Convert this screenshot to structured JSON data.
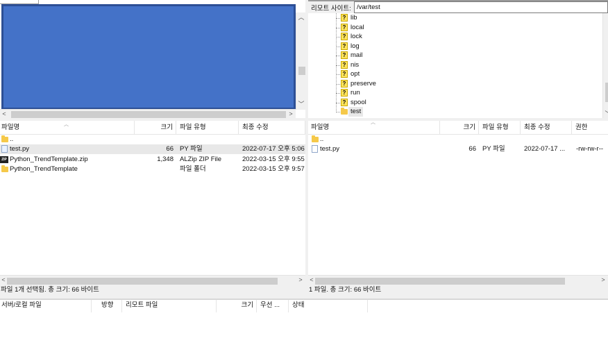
{
  "remote_site": {
    "label": "리모트 사이트:",
    "path": "/var/test"
  },
  "remote_tree": {
    "items": [
      {
        "label": "lib",
        "icon": "question-folder-icon"
      },
      {
        "label": "local",
        "icon": "question-folder-icon"
      },
      {
        "label": "lock",
        "icon": "question-folder-icon"
      },
      {
        "label": "log",
        "icon": "question-folder-icon"
      },
      {
        "label": "mail",
        "icon": "question-folder-icon"
      },
      {
        "label": "nis",
        "icon": "question-folder-icon"
      },
      {
        "label": "opt",
        "icon": "question-folder-icon"
      },
      {
        "label": "preserve",
        "icon": "question-folder-icon"
      },
      {
        "label": "run",
        "icon": "question-folder-icon"
      },
      {
        "label": "spool",
        "icon": "question-folder-icon"
      },
      {
        "label": "test",
        "icon": "folder-icon"
      }
    ]
  },
  "local_list": {
    "columns": {
      "name": "파일명",
      "size": "크기",
      "type": "파일 유형",
      "modified": "최종 수정"
    },
    "parent": "..",
    "rows": [
      {
        "name": "test.py",
        "size": "66",
        "type": "PY 파일",
        "modified": "2022-07-17 오후 5:06",
        "icon": "python-file-icon"
      },
      {
        "name": "Python_TrendTemplate.zip",
        "size": "1,348",
        "type": "ALZip ZIP File",
        "modified": "2022-03-15 오후 9:55",
        "icon": "zip-file-icon"
      },
      {
        "name": "Python_TrendTemplate",
        "size": "",
        "type": "파일 폴더",
        "modified": "2022-03-15 오후 9:57",
        "icon": "folder-icon"
      }
    ],
    "status": "파일 1개 선택됨. 총 크기: 66 바이트"
  },
  "remote_list": {
    "columns": {
      "name": "파일명",
      "size": "크기",
      "type": "파일 유형",
      "modified": "최종 수정",
      "perms": "권한"
    },
    "parent": "..",
    "rows": [
      {
        "name": "test.py",
        "size": "66",
        "type": "PY 파일",
        "modified": "2022-07-17 ...",
        "perms": "-rw-rw-r--",
        "icon": "file-icon"
      }
    ],
    "status": "1 파일. 총 크기: 66 바이트"
  },
  "queue": {
    "columns": {
      "server_file": "서버/로컬 파일",
      "direction": "방향",
      "remote_file": "리모트 파일",
      "size": "크기",
      "priority": "우선 ...",
      "status": "상태"
    }
  },
  "colors": {
    "local_tree_redaction": "#4472c8",
    "redaction_border": "#2d4f95"
  }
}
